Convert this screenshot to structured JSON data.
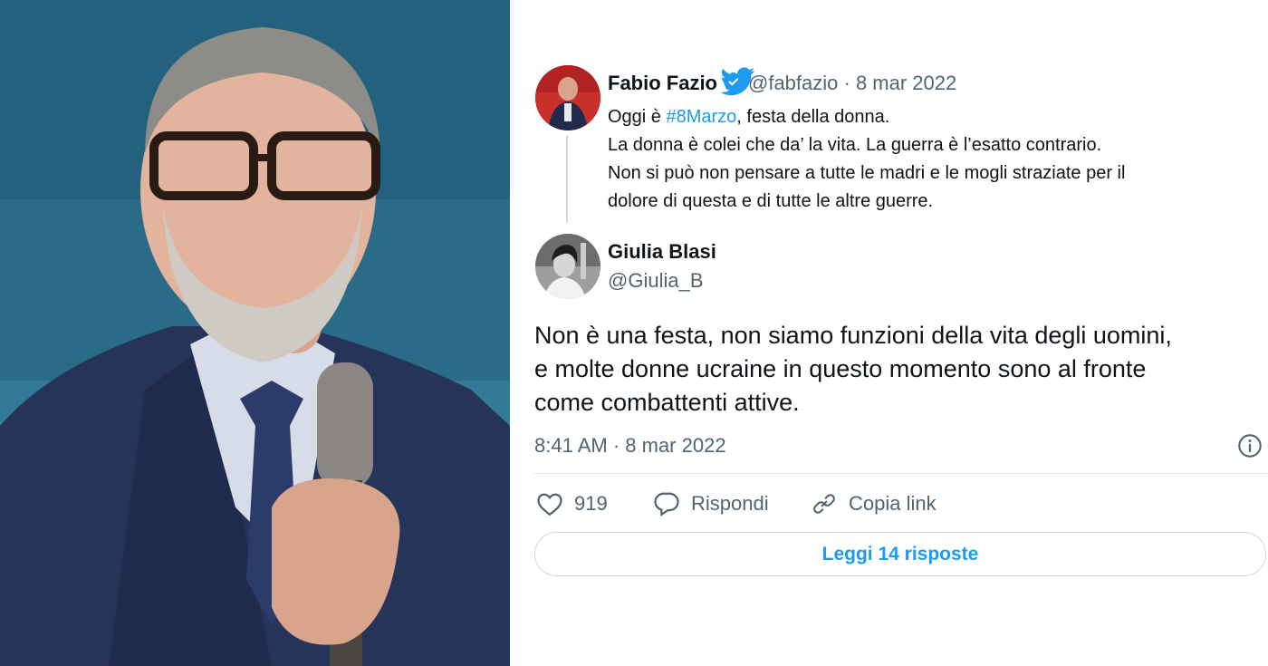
{
  "quoted_tweet": {
    "author_name": "Fabio Fazio",
    "handle_date": "@fabfazio · 8 mar 2022",
    "text_line1_before": "Oggi è ",
    "hashtag": "#8Marzo",
    "text_line1_after": ", festa della donna.",
    "text_line2": "La donna è colei che da’ la vita. La guerra è l’esatto contrario.",
    "text_line3": "Non si può non pensare a tutte le madri e le mogli straziate per il",
    "text_line4": "dolore di questa e di tutte le altre guerre."
  },
  "main_tweet": {
    "author_name": "Giulia Blasi",
    "handle": "@Giulia_B",
    "text_line1": "Non è una festa, non siamo funzioni della vita degli uomini,",
    "text_line2": "e molte donne ucraine in questo momento sono al fronte",
    "text_line3": "come combattenti attive.",
    "timestamp": "8:41 AM · 8 mar 2022"
  },
  "actions": {
    "like_count": "919",
    "reply_label": "Rispondi",
    "copy_link_label": "Copia link"
  },
  "read_replies_label": "Leggi 14 risposte",
  "icons": [
    "twitter-bird-icon",
    "verified-badge-icon",
    "info-icon",
    "heart-icon",
    "reply-bubble-icon",
    "link-icon"
  ],
  "colors": {
    "accent": "#1d9bf0",
    "text_primary": "#0f1419",
    "text_secondary": "#536471",
    "border": "#cfd9de"
  }
}
